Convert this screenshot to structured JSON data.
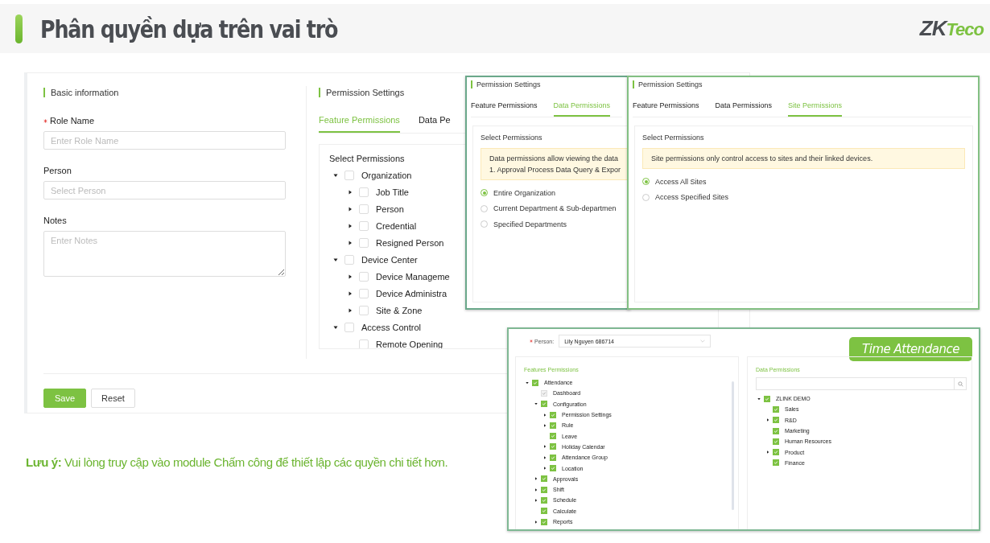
{
  "header": {
    "title": "Phân quyền dựa trên vai trò",
    "logo": {
      "dark": "ZK",
      "green": "Teco"
    }
  },
  "role_form": {
    "basic_title": "Basic information",
    "fields": [
      {
        "label": "Role Name",
        "required": true,
        "placeholder": "Enter Role Name",
        "kind": "input"
      },
      {
        "label": "Person",
        "required": false,
        "placeholder": "Select Person",
        "kind": "input"
      },
      {
        "label": "Notes",
        "required": false,
        "placeholder": "Enter Notes",
        "kind": "textarea"
      }
    ],
    "permission_title": "Permission Settings",
    "tabs": [
      {
        "label": "Feature Permissions",
        "selected": true
      },
      {
        "label": "Data Pe",
        "selected": false
      }
    ],
    "tree_title": "Select Permissions",
    "tree": [
      {
        "label": "Organization",
        "checked": false,
        "expanded": true,
        "children": [
          {
            "label": "Job Title",
            "checked": false,
            "expanded": false
          },
          {
            "label": "Person",
            "checked": false,
            "expanded": false
          },
          {
            "label": "Credential",
            "checked": false,
            "expanded": false
          },
          {
            "label": "Resigned Person",
            "checked": false,
            "expanded": false
          }
        ]
      },
      {
        "label": "Device Center",
        "checked": false,
        "expanded": true,
        "children": [
          {
            "label": "Device Manageme",
            "checked": false,
            "expanded": false
          },
          {
            "label": "Device Administra",
            "checked": false,
            "expanded": false
          },
          {
            "label": "Site & Zone",
            "checked": false,
            "expanded": false
          }
        ]
      },
      {
        "label": "Access Control",
        "checked": false,
        "expanded": true,
        "children": [
          {
            "label": "Remote Opening",
            "checked": false
          }
        ]
      }
    ],
    "buttons": [
      {
        "label": "Save",
        "primary": true
      },
      {
        "label": "Reset",
        "primary": false
      }
    ]
  },
  "data_window": {
    "title": "Permission Settings",
    "tabs": [
      {
        "label": "Feature Permissions",
        "selected": false
      },
      {
        "label": "Data Permissions",
        "selected": true
      }
    ],
    "section": "Select Permissions",
    "notice": [
      "Data permissions allow viewing the data",
      "1. Approval Process Data Query & Expor"
    ],
    "options": [
      {
        "label": "Entire Organization",
        "selected": true
      },
      {
        "label": "Current Department & Sub-departmen",
        "selected": false
      },
      {
        "label": "Specified Departments",
        "selected": false
      }
    ]
  },
  "site_window": {
    "title": "Permission Settings",
    "tabs": [
      {
        "label": "Feature Permissions",
        "selected": false
      },
      {
        "label": "Data Permissions",
        "selected": false
      },
      {
        "label": "Site Permissions",
        "selected": true
      }
    ],
    "section": "Select Permissions",
    "notice": "Site permissions only control access to sites and their linked devices.",
    "options": [
      {
        "label": "Access All Sites",
        "selected": true
      },
      {
        "label": "Access Specified Sites",
        "selected": false
      }
    ]
  },
  "attendance_window": {
    "person_label": "Person:",
    "person_required": true,
    "person_value": "Lily Nguyen 686714",
    "badge": "Time Attendance",
    "features_title": "Features Permissions",
    "features_tree": [
      {
        "label": "Attendance",
        "checked": true,
        "disabled": false,
        "expanded": true,
        "children": [
          {
            "label": "Dashboard",
            "checked": true,
            "disabled": true
          },
          {
            "label": "Configuration",
            "checked": true,
            "disabled": false,
            "expanded": true,
            "children": [
              {
                "label": "Permission Settings",
                "checked": true,
                "disabled": false,
                "expanded": false
              },
              {
                "label": "Rule",
                "checked": true,
                "disabled": false,
                "expanded": false
              },
              {
                "label": "Leave",
                "checked": true,
                "disabled": false
              },
              {
                "label": "Holiday Calendar",
                "checked": true,
                "disabled": false,
                "expanded": false
              },
              {
                "label": "Attendance Group",
                "checked": true,
                "disabled": false,
                "expanded": false
              },
              {
                "label": "Location",
                "checked": true,
                "disabled": false,
                "expanded": false
              }
            ]
          },
          {
            "label": "Approvals",
            "checked": true,
            "disabled": false,
            "expanded": false
          },
          {
            "label": "Shift",
            "checked": true,
            "disabled": false,
            "expanded": false
          },
          {
            "label": "Schedule",
            "checked": true,
            "disabled": false,
            "expanded": false
          },
          {
            "label": "Calculate",
            "checked": true,
            "disabled": false
          },
          {
            "label": "Reports",
            "checked": true,
            "disabled": false,
            "expanded": false
          }
        ]
      }
    ],
    "data_title": "Data Permissions",
    "data_tree": [
      {
        "label": "ZLINK DEMO",
        "checked": true,
        "expanded": true,
        "children": [
          {
            "label": "Sales",
            "checked": true
          },
          {
            "label": "R&D",
            "checked": true,
            "expanded": false
          },
          {
            "label": "Marketing",
            "checked": true
          },
          {
            "label": "Human Resources",
            "checked": true
          },
          {
            "label": "Product",
            "checked": true,
            "expanded": false
          },
          {
            "label": "Finance",
            "checked": true
          }
        ]
      }
    ]
  },
  "note": "**Lưu ý:** Vui lòng truy cập vào module Chấm công để thiết lập các quyền chi tiết hơn."
}
